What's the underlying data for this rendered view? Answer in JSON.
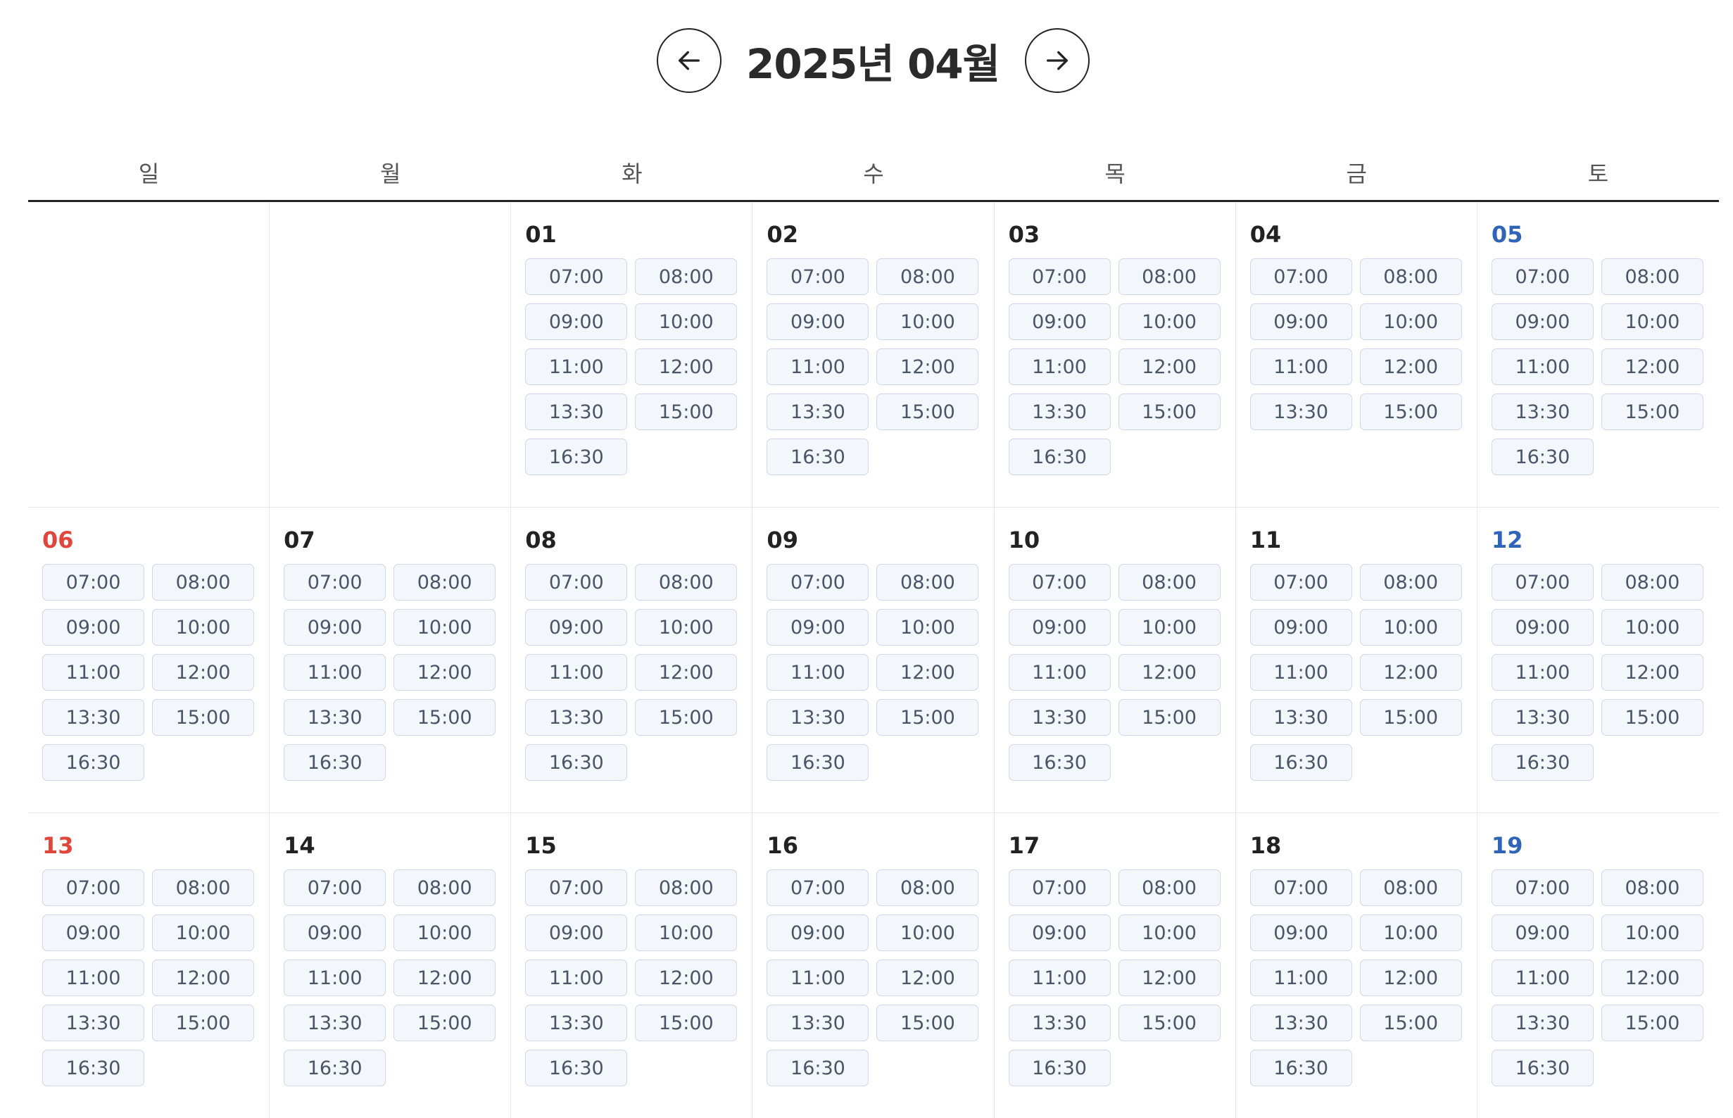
{
  "header": {
    "title": "2025년 04월",
    "prev_icon": "arrow-left-icon",
    "next_icon": "arrow-right-icon"
  },
  "weekdays": [
    "일",
    "월",
    "화",
    "수",
    "목",
    "금",
    "토"
  ],
  "colors": {
    "sunday": "#e0463b",
    "saturday": "#2f64b9",
    "slot_bg": "#f3f6fb",
    "slot_border": "#cfd8e8"
  },
  "weeks": [
    [
      {
        "day": "",
        "slots": []
      },
      {
        "day": "",
        "slots": []
      },
      {
        "day": "01",
        "slots": [
          "07:00",
          "08:00",
          "09:00",
          "10:00",
          "11:00",
          "12:00",
          "13:30",
          "15:00",
          "16:30"
        ]
      },
      {
        "day": "02",
        "slots": [
          "07:00",
          "08:00",
          "09:00",
          "10:00",
          "11:00",
          "12:00",
          "13:30",
          "15:00",
          "16:30"
        ]
      },
      {
        "day": "03",
        "slots": [
          "07:00",
          "08:00",
          "09:00",
          "10:00",
          "11:00",
          "12:00",
          "13:30",
          "15:00",
          "16:30"
        ]
      },
      {
        "day": "04",
        "slots": [
          "07:00",
          "08:00",
          "09:00",
          "10:00",
          "11:00",
          "12:00",
          "13:30",
          "15:00"
        ]
      },
      {
        "day": "05",
        "slots": [
          "07:00",
          "08:00",
          "09:00",
          "10:00",
          "11:00",
          "12:00",
          "13:30",
          "15:00",
          "16:30"
        ]
      }
    ],
    [
      {
        "day": "06",
        "slots": [
          "07:00",
          "08:00",
          "09:00",
          "10:00",
          "11:00",
          "12:00",
          "13:30",
          "15:00",
          "16:30"
        ]
      },
      {
        "day": "07",
        "slots": [
          "07:00",
          "08:00",
          "09:00",
          "10:00",
          "11:00",
          "12:00",
          "13:30",
          "15:00",
          "16:30"
        ]
      },
      {
        "day": "08",
        "slots": [
          "07:00",
          "08:00",
          "09:00",
          "10:00",
          "11:00",
          "12:00",
          "13:30",
          "15:00",
          "16:30"
        ]
      },
      {
        "day": "09",
        "slots": [
          "07:00",
          "08:00",
          "09:00",
          "10:00",
          "11:00",
          "12:00",
          "13:30",
          "15:00",
          "16:30"
        ]
      },
      {
        "day": "10",
        "slots": [
          "07:00",
          "08:00",
          "09:00",
          "10:00",
          "11:00",
          "12:00",
          "13:30",
          "15:00",
          "16:30"
        ]
      },
      {
        "day": "11",
        "slots": [
          "07:00",
          "08:00",
          "09:00",
          "10:00",
          "11:00",
          "12:00",
          "13:30",
          "15:00",
          "16:30"
        ]
      },
      {
        "day": "12",
        "slots": [
          "07:00",
          "08:00",
          "09:00",
          "10:00",
          "11:00",
          "12:00",
          "13:30",
          "15:00",
          "16:30"
        ]
      }
    ],
    [
      {
        "day": "13",
        "slots": [
          "07:00",
          "08:00",
          "09:00",
          "10:00",
          "11:00",
          "12:00",
          "13:30",
          "15:00",
          "16:30"
        ]
      },
      {
        "day": "14",
        "slots": [
          "07:00",
          "08:00",
          "09:00",
          "10:00",
          "11:00",
          "12:00",
          "13:30",
          "15:00",
          "16:30"
        ]
      },
      {
        "day": "15",
        "slots": [
          "07:00",
          "08:00",
          "09:00",
          "10:00",
          "11:00",
          "12:00",
          "13:30",
          "15:00",
          "16:30"
        ]
      },
      {
        "day": "16",
        "slots": [
          "07:00",
          "08:00",
          "09:00",
          "10:00",
          "11:00",
          "12:00",
          "13:30",
          "15:00",
          "16:30"
        ]
      },
      {
        "day": "17",
        "slots": [
          "07:00",
          "08:00",
          "09:00",
          "10:00",
          "11:00",
          "12:00",
          "13:30",
          "15:00",
          "16:30"
        ]
      },
      {
        "day": "18",
        "slots": [
          "07:00",
          "08:00",
          "09:00",
          "10:00",
          "11:00",
          "12:00",
          "13:30",
          "15:00",
          "16:30"
        ]
      },
      {
        "day": "19",
        "slots": [
          "07:00",
          "08:00",
          "09:00",
          "10:00",
          "11:00",
          "12:00",
          "13:30",
          "15:00",
          "16:30"
        ]
      }
    ]
  ]
}
